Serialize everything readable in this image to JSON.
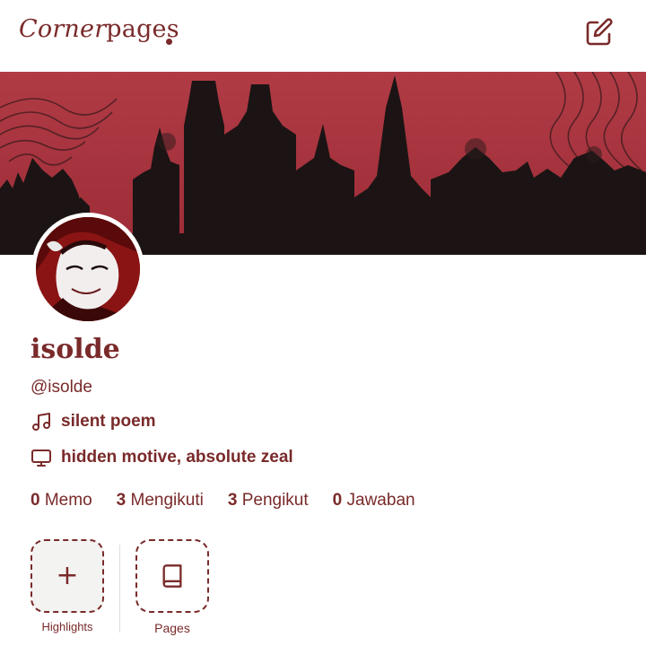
{
  "header": {
    "logo_part1": "Corner",
    "logo_part2": "pages",
    "edit_icon": "edit-icon"
  },
  "profile": {
    "name": "isolde",
    "handle": "@isolde",
    "music_icon": "music-note-icon",
    "music_text": "silent poem",
    "tv_icon": "monitor-icon",
    "tv_text": "hidden motive, absolute zeal"
  },
  "stats": [
    {
      "count": "0",
      "label": "Memo"
    },
    {
      "count": "3",
      "label": "Mengikuti"
    },
    {
      "count": "3",
      "label": "Pengikut"
    },
    {
      "count": "0",
      "label": "Jawaban"
    }
  ],
  "highlights": {
    "add_symbol": "+",
    "add_label": "Highlights",
    "pages_icon": "book-icon",
    "pages_label": "Pages"
  },
  "colors": {
    "accent": "#7a2a2a",
    "banner_red": "#a6323d",
    "silhouette": "#1c1414"
  }
}
